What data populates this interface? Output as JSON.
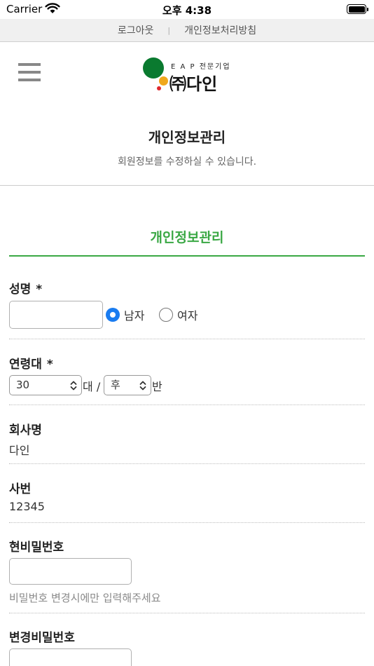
{
  "status_bar": {
    "carrier": "Carrier",
    "time": "오후 4:38"
  },
  "top_links": {
    "logout": "로그아웃",
    "separator": "|",
    "privacy_policy": "개인정보처리방침"
  },
  "logo": {
    "tagline": "E A P 전문기업",
    "name": "㈜다인",
    "colors": {
      "green": "#0a7a2f",
      "orange": "#f0a81c",
      "red": "#e0282e"
    }
  },
  "page": {
    "heading": "개인정보관리",
    "subtitle": "회원정보를 수정하실 수 있습니다."
  },
  "section": {
    "title": "개인정보관리",
    "accent_color": "#3aa844"
  },
  "form": {
    "name": {
      "label": "성명",
      "required_mark": "*",
      "value": "",
      "placeholder": ""
    },
    "gender": {
      "options": [
        "남자",
        "여자"
      ],
      "selected": "남자"
    },
    "age": {
      "label": "연령대",
      "required_mark": "*",
      "decade_value": "30",
      "decade_unit": "대",
      "separator": "/",
      "half_value": "후",
      "half_unit": "반"
    },
    "company": {
      "label": "회사명",
      "value": "다인"
    },
    "employee_id": {
      "label": "사번",
      "value": "12345"
    },
    "current_password": {
      "label": "현비밀번호",
      "value": "",
      "hint": "비밀번호 변경시에만 입력해주세요"
    },
    "new_password": {
      "label": "변경비밀번호",
      "value": ""
    }
  },
  "icons": {
    "menu": "hamburger-menu-icon",
    "wifi": "wifi-icon",
    "battery": "battery-icon",
    "select_chevron": "chevron-up-down-icon"
  }
}
